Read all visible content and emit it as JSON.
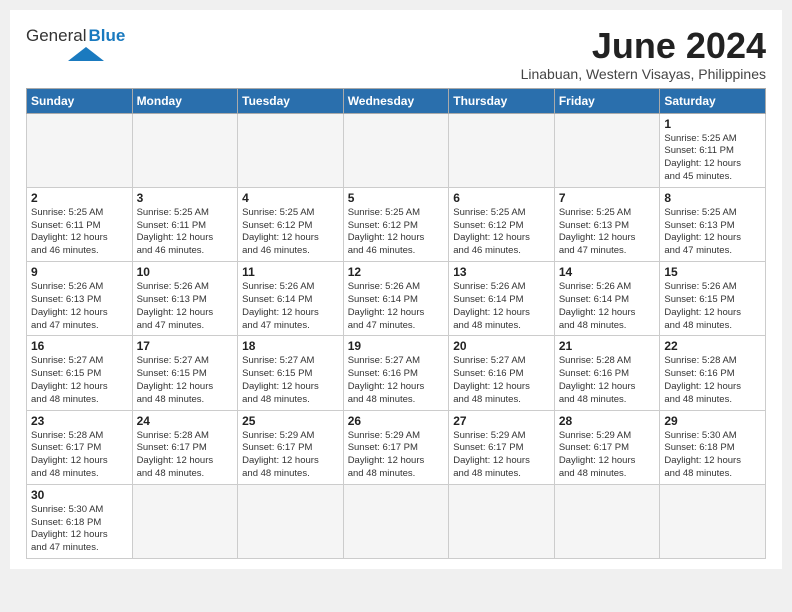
{
  "header": {
    "logo_general": "General",
    "logo_blue": "Blue",
    "month_title": "June 2024",
    "location": "Linabuan, Western Visayas, Philippines"
  },
  "days_of_week": [
    "Sunday",
    "Monday",
    "Tuesday",
    "Wednesday",
    "Thursday",
    "Friday",
    "Saturday"
  ],
  "weeks": [
    [
      {
        "day": "",
        "info": ""
      },
      {
        "day": "",
        "info": ""
      },
      {
        "day": "",
        "info": ""
      },
      {
        "day": "",
        "info": ""
      },
      {
        "day": "",
        "info": ""
      },
      {
        "day": "",
        "info": ""
      },
      {
        "day": "1",
        "info": "Sunrise: 5:25 AM\nSunset: 6:11 PM\nDaylight: 12 hours\nand 45 minutes."
      }
    ],
    [
      {
        "day": "2",
        "info": "Sunrise: 5:25 AM\nSunset: 6:11 PM\nDaylight: 12 hours\nand 46 minutes."
      },
      {
        "day": "3",
        "info": "Sunrise: 5:25 AM\nSunset: 6:11 PM\nDaylight: 12 hours\nand 46 minutes."
      },
      {
        "day": "4",
        "info": "Sunrise: 5:25 AM\nSunset: 6:12 PM\nDaylight: 12 hours\nand 46 minutes."
      },
      {
        "day": "5",
        "info": "Sunrise: 5:25 AM\nSunset: 6:12 PM\nDaylight: 12 hours\nand 46 minutes."
      },
      {
        "day": "6",
        "info": "Sunrise: 5:25 AM\nSunset: 6:12 PM\nDaylight: 12 hours\nand 46 minutes."
      },
      {
        "day": "7",
        "info": "Sunrise: 5:25 AM\nSunset: 6:13 PM\nDaylight: 12 hours\nand 47 minutes."
      },
      {
        "day": "8",
        "info": "Sunrise: 5:25 AM\nSunset: 6:13 PM\nDaylight: 12 hours\nand 47 minutes."
      }
    ],
    [
      {
        "day": "9",
        "info": "Sunrise: 5:26 AM\nSunset: 6:13 PM\nDaylight: 12 hours\nand 47 minutes."
      },
      {
        "day": "10",
        "info": "Sunrise: 5:26 AM\nSunset: 6:13 PM\nDaylight: 12 hours\nand 47 minutes."
      },
      {
        "day": "11",
        "info": "Sunrise: 5:26 AM\nSunset: 6:14 PM\nDaylight: 12 hours\nand 47 minutes."
      },
      {
        "day": "12",
        "info": "Sunrise: 5:26 AM\nSunset: 6:14 PM\nDaylight: 12 hours\nand 47 minutes."
      },
      {
        "day": "13",
        "info": "Sunrise: 5:26 AM\nSunset: 6:14 PM\nDaylight: 12 hours\nand 48 minutes."
      },
      {
        "day": "14",
        "info": "Sunrise: 5:26 AM\nSunset: 6:14 PM\nDaylight: 12 hours\nand 48 minutes."
      },
      {
        "day": "15",
        "info": "Sunrise: 5:26 AM\nSunset: 6:15 PM\nDaylight: 12 hours\nand 48 minutes."
      }
    ],
    [
      {
        "day": "16",
        "info": "Sunrise: 5:27 AM\nSunset: 6:15 PM\nDaylight: 12 hours\nand 48 minutes."
      },
      {
        "day": "17",
        "info": "Sunrise: 5:27 AM\nSunset: 6:15 PM\nDaylight: 12 hours\nand 48 minutes."
      },
      {
        "day": "18",
        "info": "Sunrise: 5:27 AM\nSunset: 6:15 PM\nDaylight: 12 hours\nand 48 minutes."
      },
      {
        "day": "19",
        "info": "Sunrise: 5:27 AM\nSunset: 6:16 PM\nDaylight: 12 hours\nand 48 minutes."
      },
      {
        "day": "20",
        "info": "Sunrise: 5:27 AM\nSunset: 6:16 PM\nDaylight: 12 hours\nand 48 minutes."
      },
      {
        "day": "21",
        "info": "Sunrise: 5:28 AM\nSunset: 6:16 PM\nDaylight: 12 hours\nand 48 minutes."
      },
      {
        "day": "22",
        "info": "Sunrise: 5:28 AM\nSunset: 6:16 PM\nDaylight: 12 hours\nand 48 minutes."
      }
    ],
    [
      {
        "day": "23",
        "info": "Sunrise: 5:28 AM\nSunset: 6:17 PM\nDaylight: 12 hours\nand 48 minutes."
      },
      {
        "day": "24",
        "info": "Sunrise: 5:28 AM\nSunset: 6:17 PM\nDaylight: 12 hours\nand 48 minutes."
      },
      {
        "day": "25",
        "info": "Sunrise: 5:29 AM\nSunset: 6:17 PM\nDaylight: 12 hours\nand 48 minutes."
      },
      {
        "day": "26",
        "info": "Sunrise: 5:29 AM\nSunset: 6:17 PM\nDaylight: 12 hours\nand 48 minutes."
      },
      {
        "day": "27",
        "info": "Sunrise: 5:29 AM\nSunset: 6:17 PM\nDaylight: 12 hours\nand 48 minutes."
      },
      {
        "day": "28",
        "info": "Sunrise: 5:29 AM\nSunset: 6:17 PM\nDaylight: 12 hours\nand 48 minutes."
      },
      {
        "day": "29",
        "info": "Sunrise: 5:30 AM\nSunset: 6:18 PM\nDaylight: 12 hours\nand 48 minutes."
      }
    ],
    [
      {
        "day": "30",
        "info": "Sunrise: 5:30 AM\nSunset: 6:18 PM\nDaylight: 12 hours\nand 47 minutes."
      },
      {
        "day": "",
        "info": ""
      },
      {
        "day": "",
        "info": ""
      },
      {
        "day": "",
        "info": ""
      },
      {
        "day": "",
        "info": ""
      },
      {
        "day": "",
        "info": ""
      },
      {
        "day": "",
        "info": ""
      }
    ]
  ]
}
